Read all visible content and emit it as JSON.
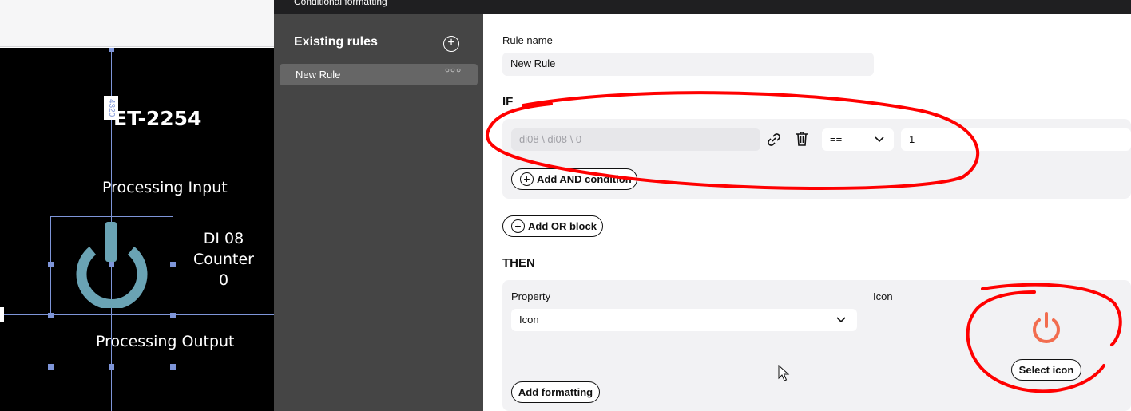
{
  "dialog": {
    "title": "Conditional formatting"
  },
  "canvas": {
    "dimension_label": "4320",
    "device_title": "ET-2254",
    "processing_input": "Processing Input",
    "processing_output": "Processing Output",
    "di_block": {
      "line1": "DI 08",
      "line2": "Counter",
      "line3": "0"
    },
    "power_icon_color": "#6aa3b4"
  },
  "sidebar": {
    "heading": "Existing rules",
    "add_icon": "plus-circle-icon",
    "rules": [
      {
        "label": "New Rule",
        "menu_icon": "more-icon"
      }
    ]
  },
  "editor": {
    "rule_name_label": "Rule name",
    "rule_name_value": "New Rule",
    "if_title": "IF",
    "condition": {
      "source": "di08 \\ di08 \\ 0",
      "link_icon": "link-icon",
      "delete_icon": "trash-icon",
      "operator": "==",
      "value": "1"
    },
    "add_and_label": "Add AND condition",
    "add_or_label": "Add OR block",
    "then_title": "THEN",
    "property_label": "Property",
    "property_value": "Icon",
    "icon_label": "Icon",
    "selected_icon": "power-icon",
    "selected_icon_color": "#f26d4f",
    "select_icon_label": "Select icon",
    "add_formatting_label": "Add formatting"
  },
  "annotation_color": "#ff0000"
}
